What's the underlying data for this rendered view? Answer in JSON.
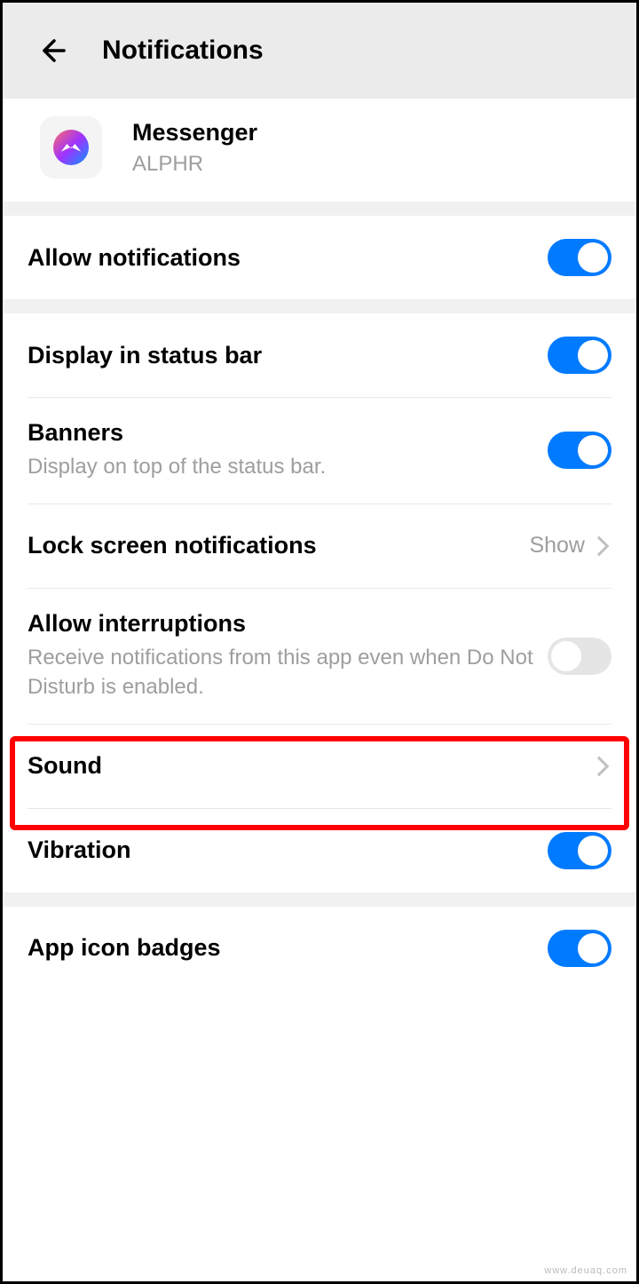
{
  "header": {
    "title": "Notifications"
  },
  "app": {
    "name": "Messenger",
    "subtitle": "ALPHR"
  },
  "rows": {
    "allow_notifications": {
      "title": "Allow notifications",
      "toggle": "on"
    },
    "display_status_bar": {
      "title": "Display in status bar",
      "toggle": "on"
    },
    "banners": {
      "title": "Banners",
      "subtitle": "Display on top of the status bar.",
      "toggle": "on"
    },
    "lock_screen": {
      "title": "Lock screen notifications",
      "value": "Show"
    },
    "allow_interruptions": {
      "title": "Allow interruptions",
      "subtitle": "Receive notifications from this app even when Do Not Disturb is enabled.",
      "toggle": "off"
    },
    "sound": {
      "title": "Sound"
    },
    "vibration": {
      "title": "Vibration",
      "toggle": "on"
    },
    "app_icon_badges": {
      "title": "App icon badges",
      "toggle": "on"
    }
  },
  "watermark": "www.deuaq.com"
}
